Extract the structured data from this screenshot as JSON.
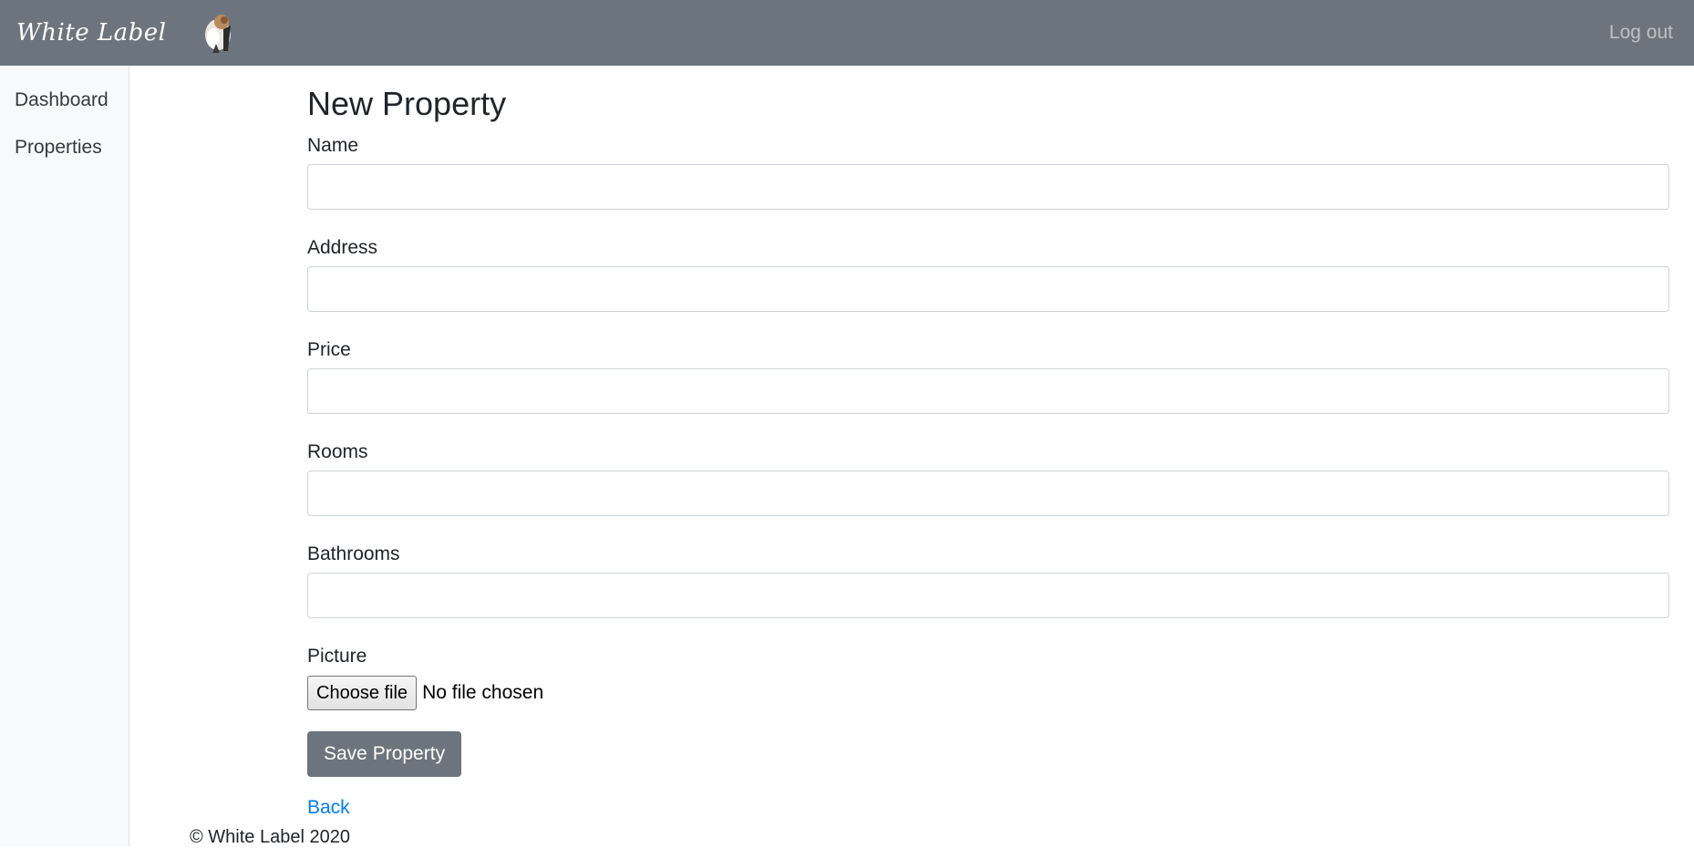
{
  "navbar": {
    "brand": "White Label",
    "logout_label": "Log out"
  },
  "sidebar": {
    "items": [
      {
        "label": "Dashboard"
      },
      {
        "label": "Properties"
      }
    ]
  },
  "form": {
    "title": "New Property",
    "fields": [
      {
        "label": "Name",
        "value": ""
      },
      {
        "label": "Address",
        "value": ""
      },
      {
        "label": "Price",
        "value": ""
      },
      {
        "label": "Rooms",
        "value": ""
      },
      {
        "label": "Bathrooms",
        "value": ""
      }
    ],
    "picture": {
      "label": "Picture",
      "button_label": "Choose file",
      "status": "No file chosen"
    },
    "submit_label": "Save Property",
    "back_label": "Back"
  },
  "footer": {
    "text": "© White Label 2020"
  },
  "colors": {
    "navbar_bg": "#6c757d",
    "sidebar_bg": "#f8f9fa",
    "link": "#007bff",
    "button_secondary": "#6c757d"
  },
  "icons": {
    "brand_mascot": "mascot-logo-icon"
  }
}
